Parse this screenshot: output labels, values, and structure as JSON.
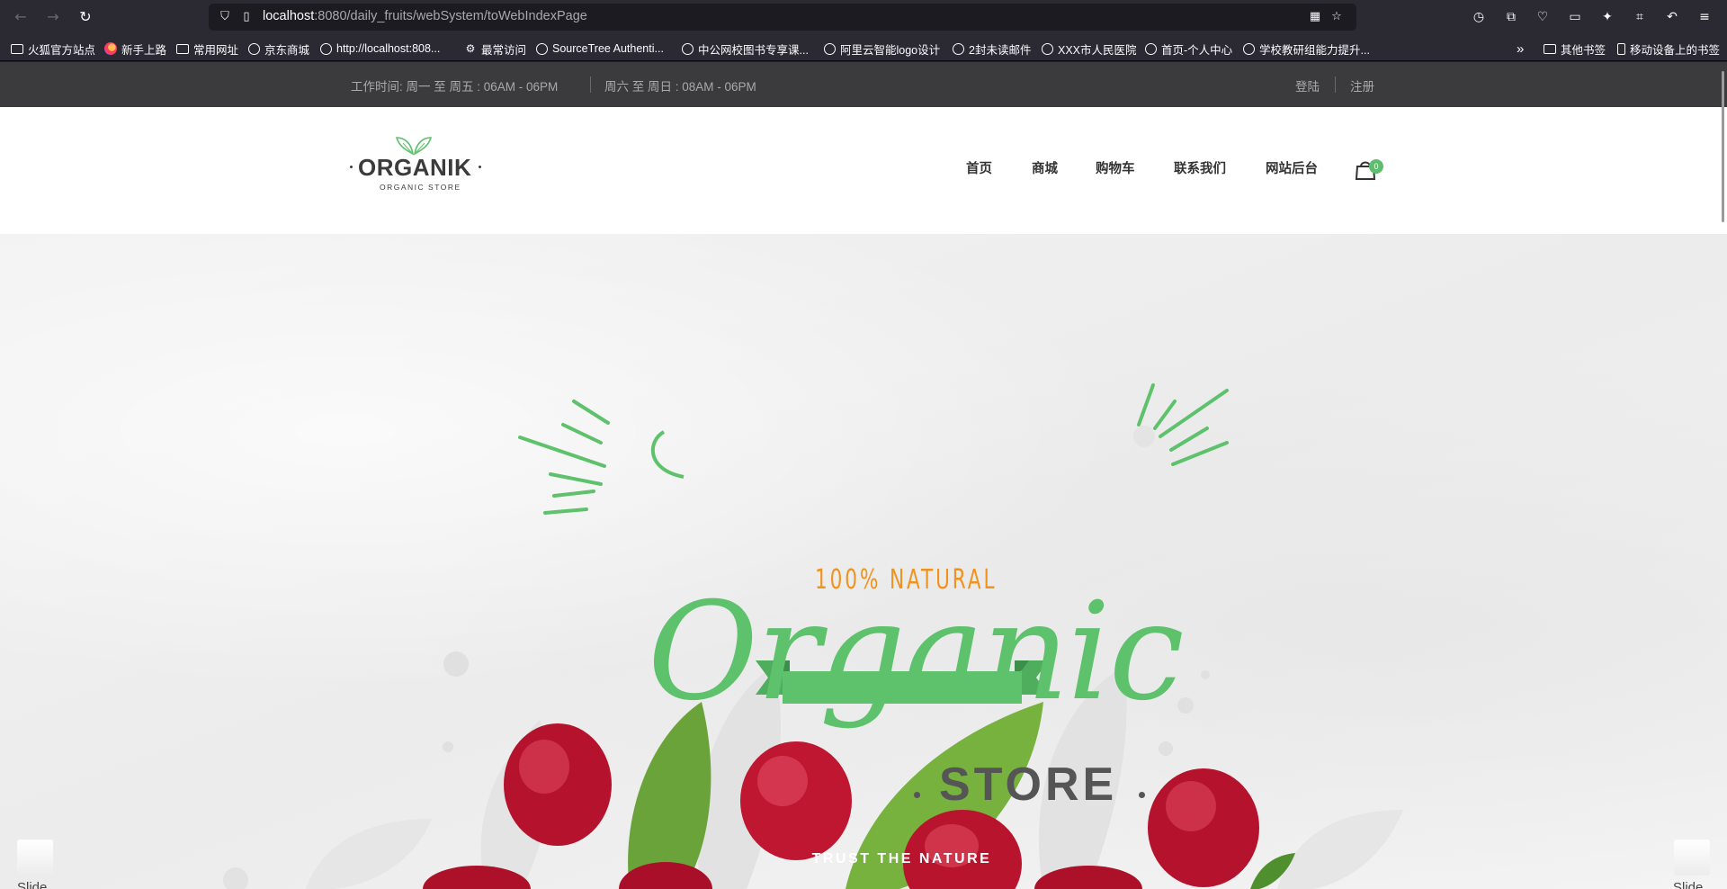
{
  "browser": {
    "url_host": "localhost",
    "url_rest": ":8080/daily_fruits/webSystem/toWebIndexPage"
  },
  "bookmarks": [
    {
      "label": "火狐官方站点",
      "icon": "folder-icon"
    },
    {
      "label": "新手上路",
      "icon": "firefox-icon"
    },
    {
      "label": "常用网址",
      "icon": "folder-icon"
    },
    {
      "label": "京东商城",
      "icon": "globe-icon"
    },
    {
      "label": "http://localhost:808...",
      "icon": "globe-icon"
    },
    {
      "label": "最常访问",
      "icon": "gear-icon"
    },
    {
      "label": "SourceTree Authenti...",
      "icon": "globe-icon"
    },
    {
      "label": "中公网校图书专享课...",
      "icon": "globe-icon"
    },
    {
      "label": "阿里云智能logo设计",
      "icon": "globe-icon"
    },
    {
      "label": "2封未读邮件",
      "icon": "globe-icon"
    },
    {
      "label": "XXX市人民医院",
      "icon": "globe-icon"
    },
    {
      "label": "首页-个人中心",
      "icon": "globe-icon"
    },
    {
      "label": "学校教研组能力提升...",
      "icon": "globe-icon"
    }
  ],
  "bookmarks_right": [
    {
      "label": "其他书签",
      "icon": "folder-icon"
    },
    {
      "label": "移动设备上的书签",
      "icon": "mobile-icon"
    }
  ],
  "topbar": {
    "weekday_hours": "工作时间:  周一  至  周五 : 06AM - 06PM",
    "weekend_hours": "周六  至  周日 : 08AM - 06PM",
    "login": "登陆",
    "register": "注册"
  },
  "header": {
    "logo_text": "ORGANIK",
    "logo_sub": "ORGANIC STORE",
    "menu": [
      "首页",
      "商城",
      "购物车",
      "联系我们",
      "网站后台"
    ],
    "cart_count": "0"
  },
  "hero": {
    "tagline": "100% NATURAL",
    "headline": "Organic",
    "subheadline": "STORE",
    "ribbon": "TRUST THE NATURE",
    "prev_label": "Slide",
    "next_label": "Slide"
  },
  "colors": {
    "accent_green": "#5ec16c",
    "accent_orange": "#f0931e",
    "topbar_bg": "#3b3b3d"
  }
}
